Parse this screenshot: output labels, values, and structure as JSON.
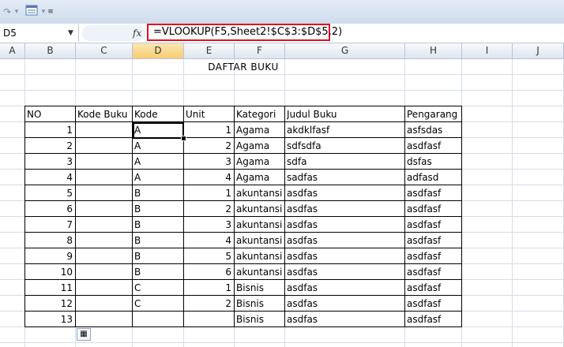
{
  "toolbar": {
    "undo": "↶",
    "redo": "↷",
    "dropdown": "▾"
  },
  "name_box": {
    "value": "D5"
  },
  "formula_bar": {
    "fx": "fx",
    "value": "=VLOOKUP(F5,Sheet2!$C$3:$D$5,2)"
  },
  "columns": [
    "A",
    "B",
    "C",
    "D",
    "E",
    "F",
    "G",
    "H",
    "I",
    "J"
  ],
  "sheet_title": "DAFTAR  BUKU",
  "table": {
    "headers": [
      "NO",
      "Kode Buku",
      "Kode",
      "Unit",
      "Kategori",
      "Judul Buku",
      "Pengarang"
    ],
    "rows": [
      [
        "1",
        "",
        "A",
        "1",
        "Agama",
        "akdklfasf",
        "asfsdas"
      ],
      [
        "2",
        "",
        "A",
        "2",
        "Agama",
        "sdfsdfa",
        "asdfasf"
      ],
      [
        "3",
        "",
        "A",
        "3",
        "Agama",
        "sdfa",
        "dsfas"
      ],
      [
        "4",
        "",
        "A",
        "4",
        "Agama",
        "sadfas",
        "adfasd"
      ],
      [
        "5",
        "",
        "B",
        "1",
        "akuntansi",
        "asdfas",
        "asdfasf"
      ],
      [
        "6",
        "",
        "B",
        "2",
        "akuntansi",
        "asdfas",
        "asdfasf"
      ],
      [
        "7",
        "",
        "B",
        "3",
        "akuntansi",
        "asdfas",
        "asdfasf"
      ],
      [
        "8",
        "",
        "B",
        "4",
        "akuntansi",
        "asdfas",
        "asdfasf"
      ],
      [
        "9",
        "",
        "B",
        "5",
        "akuntansi",
        "asdfas",
        "asdfasf"
      ],
      [
        "10",
        "",
        "B",
        "6",
        "akuntansi",
        "asdfas",
        "asdfasf"
      ],
      [
        "11",
        "",
        "C",
        "1",
        "Bisnis",
        "asdfas",
        "asdfasf"
      ],
      [
        "12",
        "",
        "C",
        "2",
        "Bisnis",
        "asdfas",
        "asdfasf"
      ],
      [
        "13",
        "",
        "",
        "",
        "Bisnis",
        "asdfas",
        "asdfasf"
      ]
    ]
  },
  "colors": {
    "formula_highlight": "#e0101f",
    "selected_column": "#f7cd72"
  }
}
